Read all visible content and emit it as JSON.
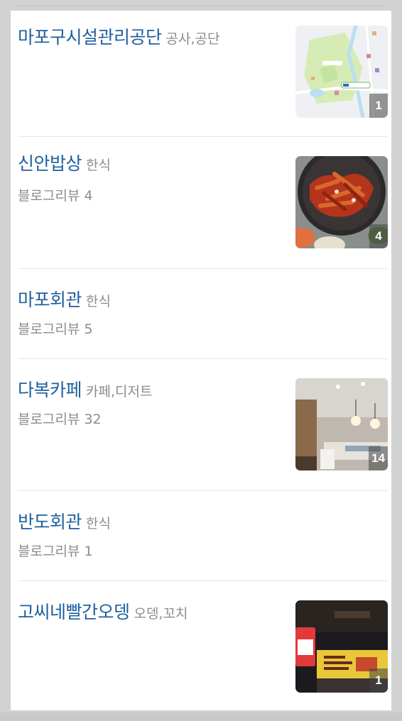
{
  "places": [
    {
      "name": "마포구시설관리공단",
      "category": "공사,공단",
      "review": "",
      "photo_count": "1",
      "thumb": "map-thumbnail"
    },
    {
      "name": "신안밥상",
      "category": "한식",
      "review": "블로그리뷰 4",
      "photo_count": "4",
      "thumb": "food-thumbnail"
    },
    {
      "name": "마포회관",
      "category": "한식",
      "review": "블로그리뷰 5",
      "photo_count": "",
      "thumb": ""
    },
    {
      "name": "다복카페",
      "category": "카페,디저트",
      "review": "블로그리뷰 32",
      "photo_count": "14",
      "thumb": "cafe-thumbnail"
    },
    {
      "name": "반도회관",
      "category": "한식",
      "review": "블로그리뷰 1",
      "photo_count": "",
      "thumb": ""
    },
    {
      "name": "고씨네빨간오뎅",
      "category": "오뎅,꼬치",
      "review": "",
      "photo_count": "1",
      "thumb": "storefront-thumbnail"
    }
  ],
  "colors": {
    "name": "#1f5f9e",
    "meta": "#8c8c8c"
  }
}
